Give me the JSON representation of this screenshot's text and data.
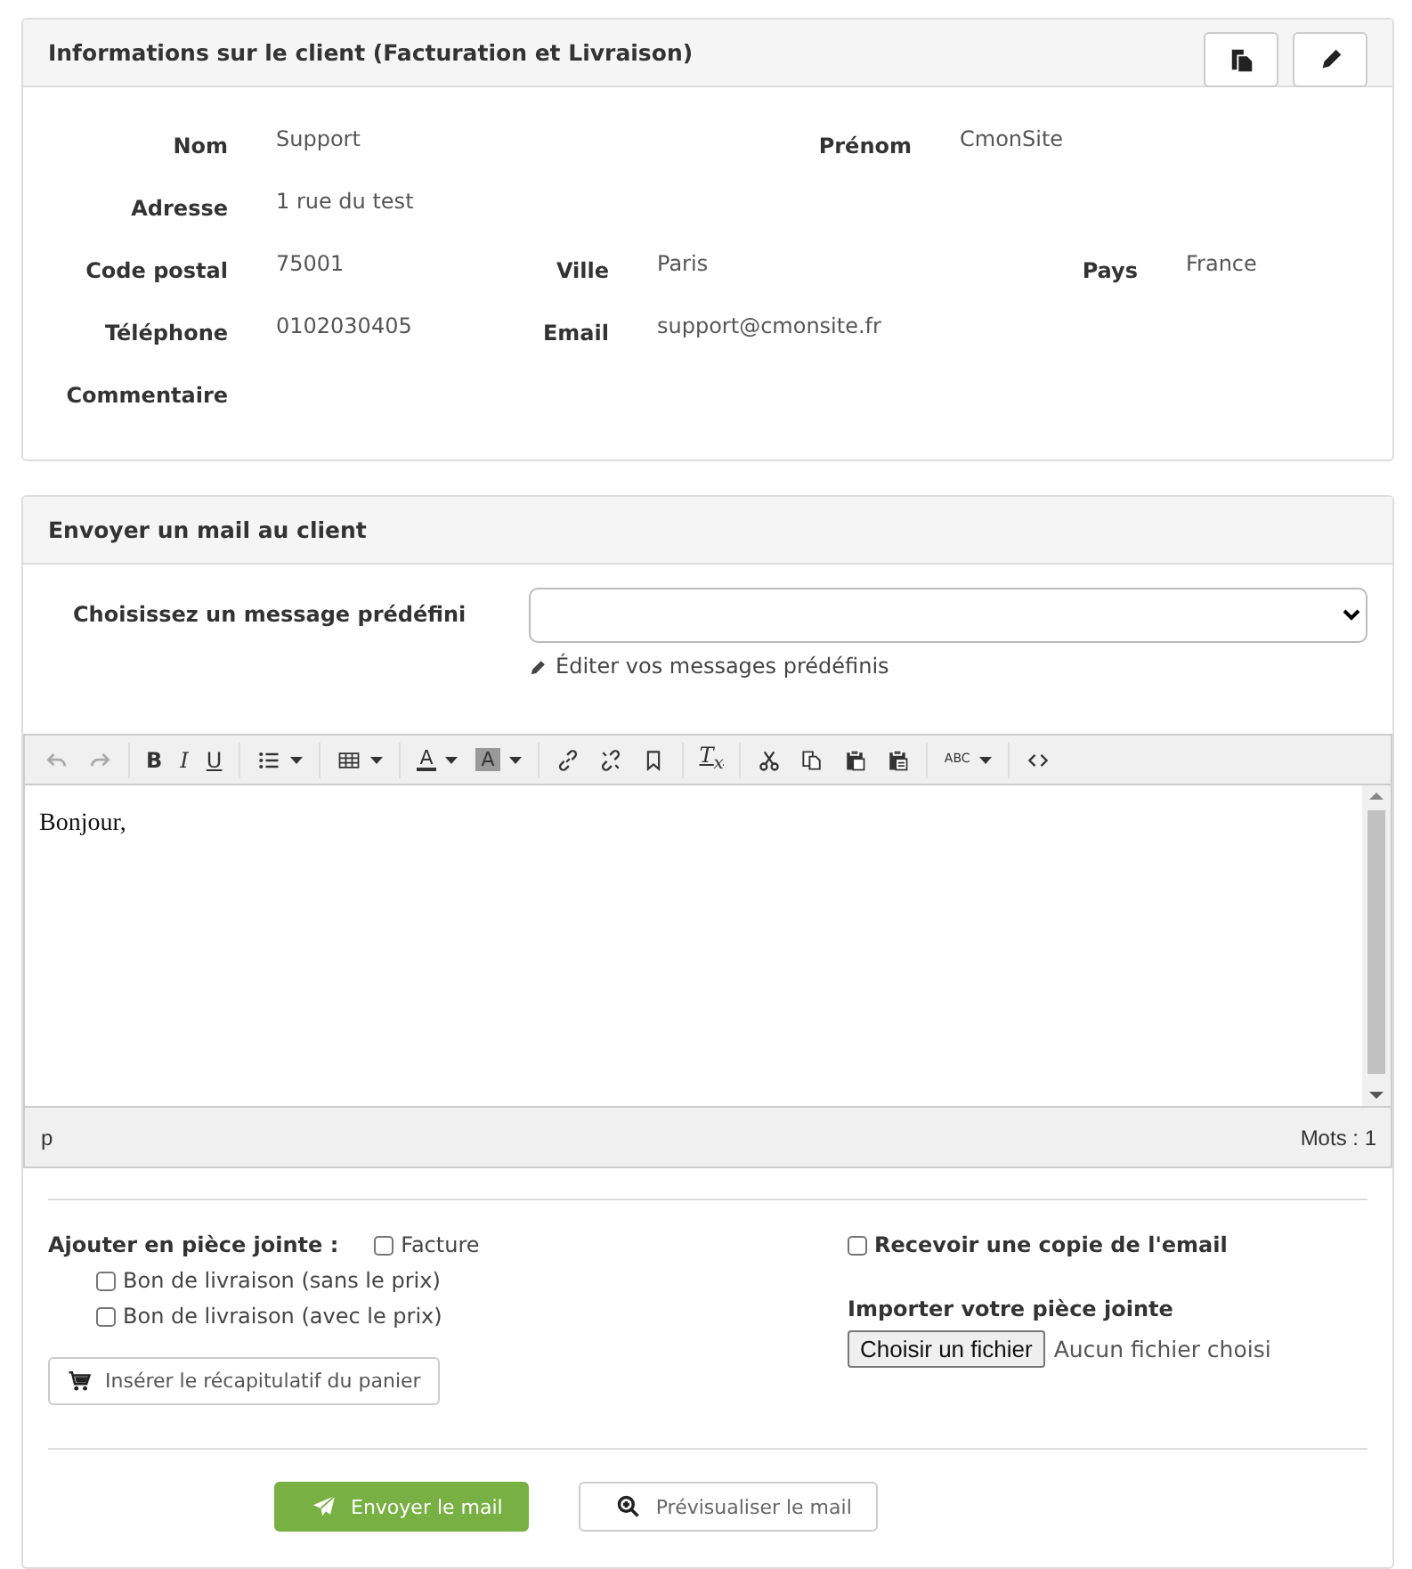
{
  "client_info": {
    "title": "Informations sur le client (Facturation et Livraison)",
    "actions": [
      {
        "kind": "copy"
      },
      {
        "kind": "edit"
      }
    ],
    "rows": [
      [
        {
          "label": "Nom",
          "value": "Support"
        },
        {
          "label": "Prénom",
          "value": "CmonSite"
        }
      ],
      [
        {
          "label": "Adresse",
          "value": "1 rue du test"
        }
      ],
      [
        {
          "label": "Code postal",
          "value": "75001"
        },
        {
          "label": "Ville",
          "value": "Paris"
        },
        {
          "label": "Pays",
          "value": "France"
        }
      ],
      [
        {
          "label": "Téléphone",
          "value": "0102030405"
        },
        {
          "label": "Email",
          "value": "support@cmonsite.fr"
        }
      ],
      [
        {
          "label": "Commentaire"
        }
      ]
    ]
  },
  "mail": {
    "title": "Envoyer un mail au client",
    "preset_label": "Choisissez un message prédéfini",
    "edit_link": "Éditer vos messages prédéfinis",
    "editor": {
      "toolbar": [
        [
          {
            "kind": "undo",
            "disabled": true,
            "menu": false
          },
          {
            "kind": "redo",
            "disabled": true,
            "menu": false
          }
        ],
        [
          {
            "kind": "bold",
            "label": "B",
            "disabled": false,
            "menu": false
          },
          {
            "kind": "italic",
            "label": "I",
            "disabled": false,
            "menu": false
          },
          {
            "kind": "underline",
            "label": "U",
            "disabled": false,
            "menu": false
          }
        ],
        [
          {
            "kind": "bullist",
            "disabled": false,
            "menu": true
          }
        ],
        [
          {
            "kind": "table",
            "disabled": false,
            "menu": true
          }
        ],
        [
          {
            "kind": "forecolor",
            "label": "A",
            "disabled": false,
            "menu": true
          },
          {
            "kind": "backcolor",
            "label": "A",
            "disabled": false,
            "menu": true
          }
        ],
        [
          {
            "kind": "link",
            "disabled": false,
            "menu": false
          },
          {
            "kind": "unlink",
            "disabled": false,
            "menu": false
          },
          {
            "kind": "anchor",
            "disabled": false,
            "menu": false
          }
        ],
        [
          {
            "kind": "removeformat",
            "label": "T$_{x}$",
            "disabled": false,
            "menu": false
          }
        ],
        [
          {
            "kind": "cut",
            "disabled": false,
            "menu": false
          },
          {
            "kind": "copy",
            "disabled": false,
            "menu": false
          },
          {
            "kind": "paste",
            "disabled": false,
            "menu": false
          },
          {
            "kind": "pastetext",
            "disabled": false,
            "menu": false
          }
        ],
        [
          {
            "kind": "spellcheck",
            "label": "ABC",
            "disabled": false,
            "menu": true
          }
        ],
        [
          {
            "kind": "code",
            "disabled": false,
            "menu": false
          }
        ]
      ],
      "body": "Bonjour,",
      "status_path": "p",
      "word_count": "Mots : 1"
    },
    "attachments": {
      "label": "Ajouter en pièce jointe :",
      "options": [
        {
          "label": "Facture",
          "checked": false
        },
        {
          "label": "Bon de livraison (sans le prix)",
          "checked": false
        },
        {
          "label": "Bon de livraison (avec le prix)",
          "checked": false
        }
      ]
    },
    "cart_button": "Insérer le récapitulatif du panier",
    "copy_option": {
      "label": "Recevoir une copie de l'email",
      "checked": false
    },
    "upload": {
      "label": "Importer votre pièce jointe",
      "button": "Choisir un fichier",
      "status": "Aucun fichier choisi"
    },
    "buttons": [
      {
        "kind": "primary",
        "label": "Envoyer le mail"
      },
      {
        "kind": "secondary",
        "label": "Prévisualiser le mail"
      }
    ]
  }
}
